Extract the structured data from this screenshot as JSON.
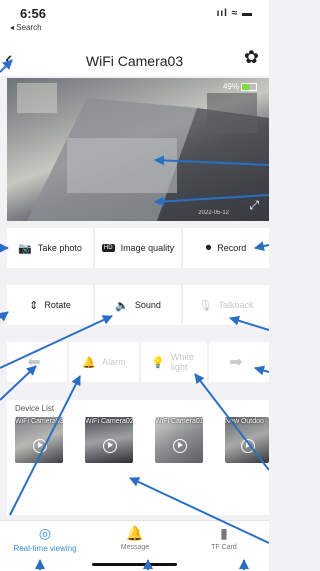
{
  "status": {
    "time": "6:56",
    "back": "◂ Search",
    "icons": "ııl ≈ ▬"
  },
  "nav": {
    "back_icon": "‹",
    "title": "WiFi Camera03",
    "settings_icon": "✿"
  },
  "video": {
    "battery": "49%",
    "battery_level": 0.49,
    "timestamp": "2022-05-12",
    "expand_icon": "⤢"
  },
  "controls": [
    {
      "icon": "📷",
      "label": "Take photo"
    },
    {
      "icon": "HD",
      "label": "Image quality"
    },
    {
      "icon": "⏺",
      "label": "Record"
    },
    {
      "icon": "⇕",
      "label": "Rotate"
    },
    {
      "icon": "🔈",
      "label": "Sound"
    },
    {
      "icon": "🎙",
      "label": "Talkback"
    },
    {
      "icon": "⬅",
      "label": ""
    },
    {
      "icon": "🔔",
      "label": "Alarm"
    },
    {
      "icon": "💡",
      "label": "White light"
    },
    {
      "icon": "➡",
      "label": ""
    }
  ],
  "device_list": {
    "label": "Device List",
    "devices": [
      {
        "name": "WiFi Camera03"
      },
      {
        "name": "WiFi Camera02"
      },
      {
        "name": "WiFi Camera01"
      },
      {
        "name": "New Outdoo"
      }
    ]
  },
  "tabs": [
    {
      "icon": "◎",
      "label": "Real-time viewing"
    },
    {
      "icon": "🔔",
      "label": "Message"
    },
    {
      "icon": "▮",
      "label": "TF Card"
    }
  ],
  "colors": {
    "accent": "#3a8fd8",
    "annotation": "#2a6fc4",
    "battery_green": "#7cdf3a"
  }
}
